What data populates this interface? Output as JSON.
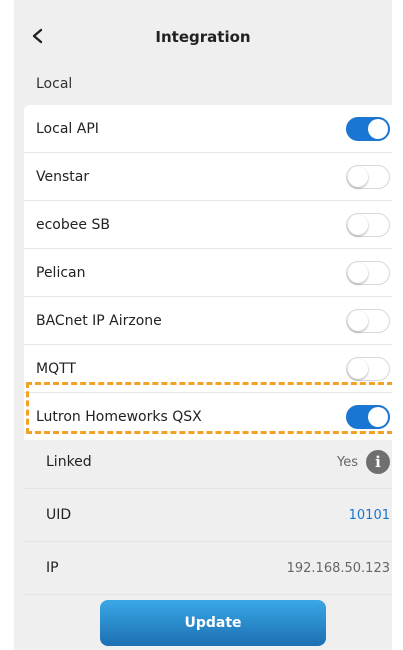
{
  "header": {
    "title": "Integration",
    "back_icon": "chevron-left-icon"
  },
  "section": {
    "label": "Local"
  },
  "integrations": [
    {
      "label": "Local API",
      "enabled": true
    },
    {
      "label": "Venstar",
      "enabled": false
    },
    {
      "label": "ecobee SB",
      "enabled": false
    },
    {
      "label": "Pelican",
      "enabled": false
    },
    {
      "label": "BACnet IP Airzone",
      "enabled": false
    },
    {
      "label": "MQTT",
      "enabled": false
    },
    {
      "label": "Lutron Homeworks QSX",
      "enabled": true
    }
  ],
  "details": {
    "linked": {
      "label": "Linked",
      "value": "Yes",
      "icon": "info-icon"
    },
    "uid": {
      "label": "UID",
      "value": "10101"
    },
    "ip": {
      "label": "IP",
      "value": "192.168.50.123"
    }
  },
  "actions": {
    "update_label": "Update"
  },
  "colors": {
    "accent": "#1976d2",
    "highlight": "#f2a224",
    "button_top": "#3aa8e6",
    "button_bottom": "#1c6fb2"
  }
}
